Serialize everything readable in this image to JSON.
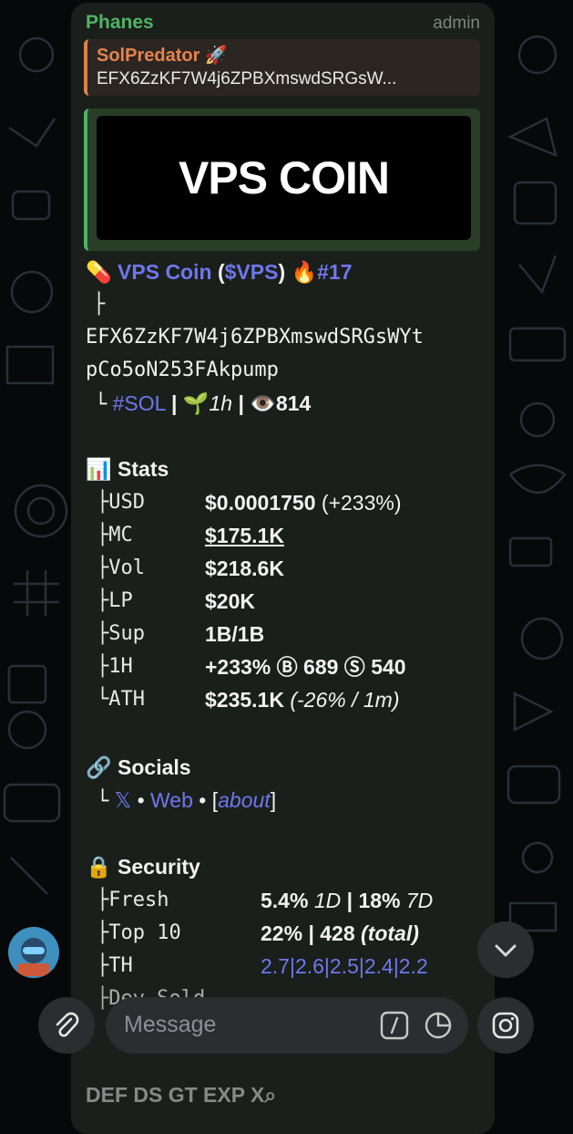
{
  "header": {
    "sender": "Phanes",
    "role": "admin"
  },
  "reply": {
    "name": "SolPredator 🚀",
    "text": "EFX6ZzKF7W4j6ZPBXmswdSRGsW..."
  },
  "banner": {
    "text": "VPS COIN"
  },
  "token": {
    "emoji": "💊",
    "name": "VPS Coin",
    "ticker_open": "(",
    "ticker": "$VPS",
    "ticker_close": ")",
    "fire": "🔥",
    "rank": "#17",
    "tree_branch": "├",
    "address_line1": "EFX6ZzKF7W4j6ZPBXmswdSRGsWYt",
    "address_line2": "pCo5oN253FAkpump",
    "tree_end": "└",
    "chain": "#SOL",
    "sep": "|",
    "sprout": "🌱",
    "age": "1h",
    "eye": "👁️",
    "views": "814"
  },
  "stats": {
    "emoji": "📊",
    "title": "Stats",
    "rows": [
      {
        "prefix": "├",
        "label": "USD",
        "value": "$0.0001750",
        "extra": " (+233%)"
      },
      {
        "prefix": "├",
        "label": "MC",
        "value": "$175.1K",
        "extra": ""
      },
      {
        "prefix": "├",
        "label": "Vol",
        "value": "$218.6K",
        "extra": ""
      },
      {
        "prefix": "├",
        "label": "LP",
        "value": "$20K",
        "extra": ""
      },
      {
        "prefix": "├",
        "label": "Sup",
        "value": "1B/1B",
        "extra": ""
      },
      {
        "prefix": "├",
        "label": "1H",
        "value": "+233% Ⓑ 689 Ⓢ 540",
        "extra": ""
      },
      {
        "prefix": "└",
        "label": "ATH",
        "value": "$235.1K",
        "extra": " (-26% / 1m)"
      }
    ]
  },
  "socials": {
    "emoji": "🔗",
    "title": "Socials",
    "prefix": "└",
    "x": "𝕏",
    "dot": "•",
    "web": "Web",
    "bracket_open": "[",
    "about": "about",
    "bracket_close": "]"
  },
  "security": {
    "emoji": "🔒",
    "title": "Security",
    "fresh": {
      "prefix": "├",
      "label": "Fresh",
      "v1": "5.4%",
      "p1": "1D",
      "sep": "|",
      "v2": "18%",
      "p2": "7D"
    },
    "top10": {
      "prefix": "├",
      "label": "Top 10",
      "v1": "22%",
      "sep": "|",
      "v2": "428",
      "p2": "(total)"
    },
    "th": {
      "prefix": "├",
      "label": "TH",
      "values": "2.7|2.6|2.5|2.4|2.2"
    },
    "devsold": {
      "prefix": "├",
      "label": "Dev Sold"
    }
  },
  "bottom_partial": "DEF DS GT EXP X⌕",
  "input": {
    "placeholder": "Message"
  },
  "colors": {
    "link": "#6f77ec",
    "sender": "#4fb363",
    "reply": "#e6834e"
  }
}
